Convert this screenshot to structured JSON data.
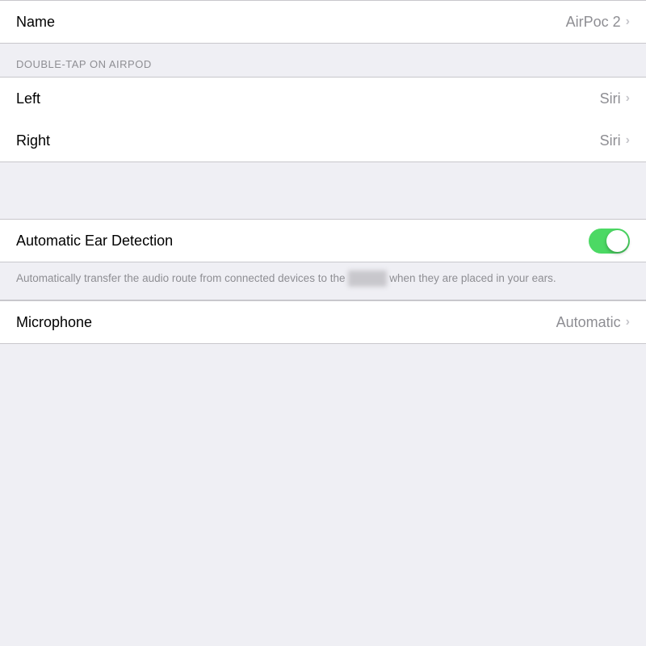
{
  "page": {
    "background_color": "#efeff4"
  },
  "name_section": {
    "rows": [
      {
        "label": "Name",
        "value": "AirPoc 2",
        "has_chevron": true
      }
    ]
  },
  "double_tap_section": {
    "header": "DOUBLE-TAP ON AIRPOD",
    "rows": [
      {
        "label": "Left",
        "value": "Siri",
        "has_chevron": true
      },
      {
        "label": "Right",
        "value": "Siri",
        "has_chevron": true
      }
    ]
  },
  "ear_detection_section": {
    "rows": [
      {
        "label": "Automatic Ear Detection",
        "toggle": true,
        "toggle_on": true
      }
    ],
    "description": "Automatically transfer the audio route from connected devices to the",
    "description_blurred": "AirPods",
    "description_suffix": " when they are placed in your ears."
  },
  "microphone_section": {
    "rows": [
      {
        "label": "Microphone",
        "value": "Automatic",
        "has_chevron": true
      }
    ]
  },
  "icons": {
    "chevron": "›"
  }
}
